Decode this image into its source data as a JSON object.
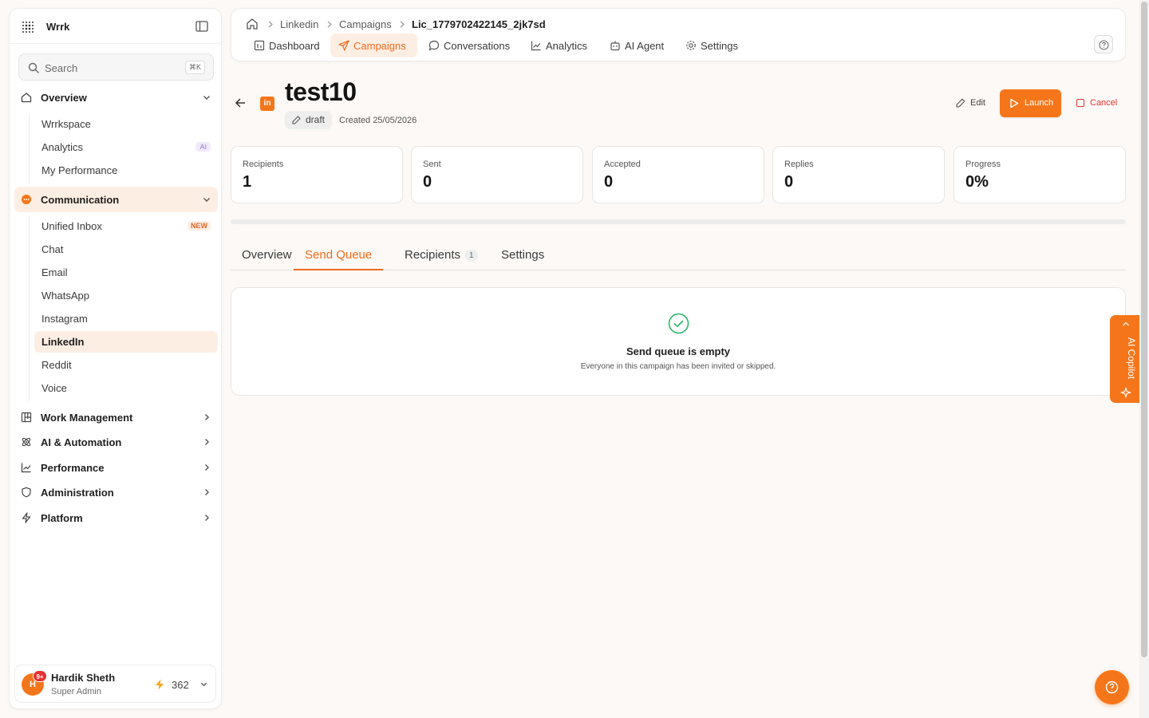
{
  "app": {
    "brand": "Wrrk"
  },
  "search": {
    "placeholder": "Search",
    "shortcut": "⌘K"
  },
  "sidebar": {
    "sections": [
      {
        "label": "Overview",
        "icon": "home-icon",
        "expanded": true,
        "items": [
          {
            "label": "Wrrkspace"
          },
          {
            "label": "Analytics",
            "badge": "AI"
          },
          {
            "label": "My Performance"
          }
        ]
      },
      {
        "label": "Communication",
        "icon": "chat-bubble-icon",
        "expanded": true,
        "active": true,
        "items": [
          {
            "label": "Unified Inbox",
            "badge": "NEW"
          },
          {
            "label": "Chat"
          },
          {
            "label": "Email"
          },
          {
            "label": "WhatsApp"
          },
          {
            "label": "Instagram"
          },
          {
            "label": "LinkedIn",
            "active": true
          },
          {
            "label": "Reddit"
          },
          {
            "label": "Voice"
          }
        ]
      },
      {
        "label": "Work Management",
        "icon": "kanban-icon"
      },
      {
        "label": "AI & Automation",
        "icon": "atom-icon"
      },
      {
        "label": "Performance",
        "icon": "trend-chart-icon"
      },
      {
        "label": "Administration",
        "icon": "shield-icon"
      },
      {
        "label": "Platform",
        "icon": "bolt-icon"
      }
    ]
  },
  "user": {
    "initial": "H",
    "notifications": "9+",
    "name": "Hardik Sheth",
    "role": "Super Admin",
    "credits": "362"
  },
  "breadcrumb": [
    "Linkedin",
    "Campaigns",
    "Lic_1779702422145_2jk7sd"
  ],
  "topnav": [
    {
      "label": "Dashboard",
      "icon": "dashboard-icon"
    },
    {
      "label": "Campaigns",
      "icon": "send-icon",
      "active": true
    },
    {
      "label": "Conversations",
      "icon": "message-icon"
    },
    {
      "label": "Analytics",
      "icon": "line-chart-icon"
    },
    {
      "label": "AI Agent",
      "icon": "bot-icon"
    },
    {
      "label": "Settings",
      "icon": "gear-icon"
    }
  ],
  "campaign": {
    "title": "test10",
    "channel_logo": "in",
    "status": "draft",
    "created": "Created 25/05/2026",
    "actions": {
      "edit": "Edit",
      "launch": "Launch",
      "cancel": "Cancel"
    }
  },
  "stats": [
    {
      "label": "Recipients",
      "value": "1"
    },
    {
      "label": "Sent",
      "value": "0"
    },
    {
      "label": "Accepted",
      "value": "0"
    },
    {
      "label": "Replies",
      "value": "0"
    },
    {
      "label": "Progress",
      "value": "0%"
    }
  ],
  "progress_fraction": 0,
  "tabs": [
    {
      "label": "Overview"
    },
    {
      "label": "Send Queue",
      "active": true
    },
    {
      "label": "Recipients",
      "count": "1"
    },
    {
      "label": "Settings"
    }
  ],
  "empty_state": {
    "title": "Send queue is empty",
    "subtitle": "Everyone in this campaign has been invited or skipped."
  },
  "copilot": {
    "label": "AI Copilot"
  },
  "colors": {
    "accent": "#f5761a",
    "accent_bg": "#fdeee4",
    "danger": "#e33232",
    "success": "#2fb56a"
  }
}
